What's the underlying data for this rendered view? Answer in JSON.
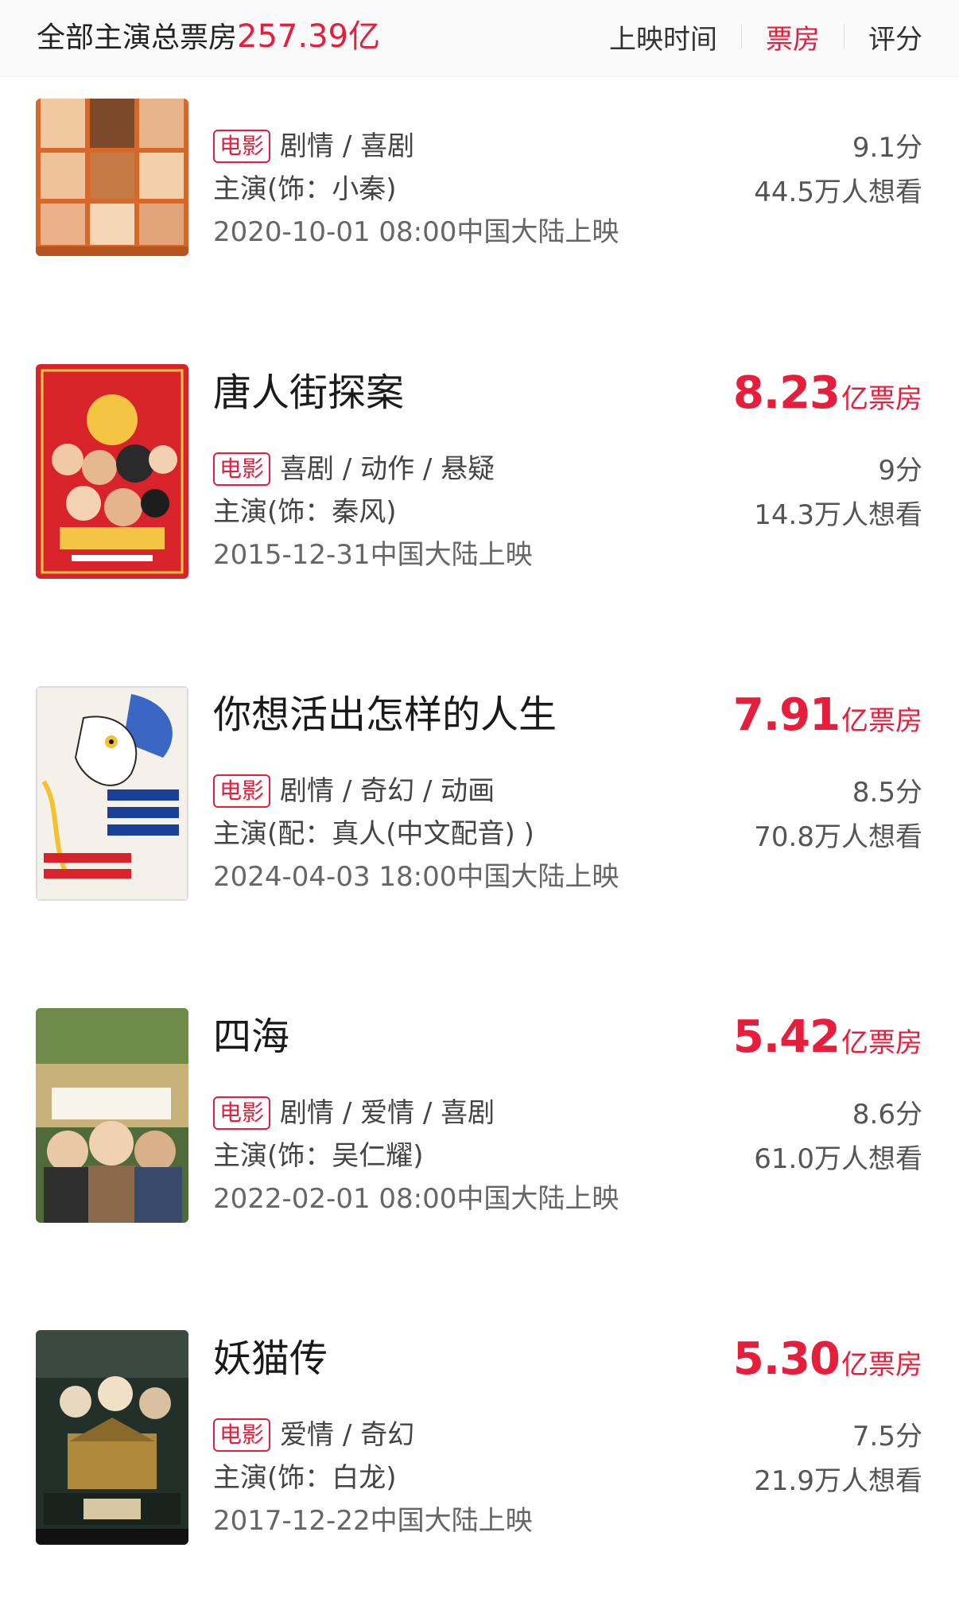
{
  "header": {
    "total_label": "全部主演总票房",
    "total_value": "257.39亿",
    "sort_tabs": [
      "上映时间",
      "票房",
      "评分"
    ],
    "active_sort": "票房"
  },
  "movies": [
    {
      "title": "",
      "boxoffice_value": "",
      "boxoffice_unit": "",
      "tag": "电影",
      "genres": "剧情 / 喜剧",
      "role": "主演(饰：小秦)",
      "release": "2020-10-01 08:00中国大陆上映",
      "rating": "9.1分",
      "wish": "44.5万人想看",
      "poster_colors": [
        "#e07a2a",
        "#b5541d"
      ]
    },
    {
      "title": "唐人街探案",
      "boxoffice_value": "8.23",
      "boxoffice_unit": "亿票房",
      "tag": "电影",
      "genres": "喜剧 / 动作 / 悬疑",
      "role": "主演(饰：秦风)",
      "release": "2015-12-31中国大陆上映",
      "rating": "9分",
      "wish": "14.3万人想看",
      "poster_colors": [
        "#d8232a",
        "#a3151b"
      ]
    },
    {
      "title": "你想活出怎样的人生",
      "boxoffice_value": "7.91",
      "boxoffice_unit": "亿票房",
      "tag": "电影",
      "genres": "剧情 / 奇幻 / 动画",
      "role": "主演(配：真人(中文配音) )",
      "release": "2024-04-03 18:00中国大陆上映",
      "rating": "8.5分",
      "wish": "70.8万人想看",
      "poster_colors": [
        "#f4f1ea",
        "#3a67c4"
      ]
    },
    {
      "title": "四海",
      "boxoffice_value": "5.42",
      "boxoffice_unit": "亿票房",
      "tag": "电影",
      "genres": "剧情 / 爱情 / 喜剧",
      "role": "主演(饰：吴仁耀)",
      "release": "2022-02-01 08:00中国大陆上映",
      "rating": "8.6分",
      "wish": "61.0万人想看",
      "poster_colors": [
        "#4f6b3a",
        "#c9b27a"
      ]
    },
    {
      "title": "妖猫传",
      "boxoffice_value": "5.30",
      "boxoffice_unit": "亿票房",
      "tag": "电影",
      "genres": "爱情 / 奇幻",
      "role": "主演(饰：白龙)",
      "release": "2017-12-22中国大陆上映",
      "rating": "7.5分",
      "wish": "21.9万人想看",
      "poster_colors": [
        "#23302a",
        "#b08a3a"
      ]
    }
  ],
  "colors": {
    "accent": "#e61e3c",
    "text": "#222222",
    "secondary": "#666666"
  }
}
